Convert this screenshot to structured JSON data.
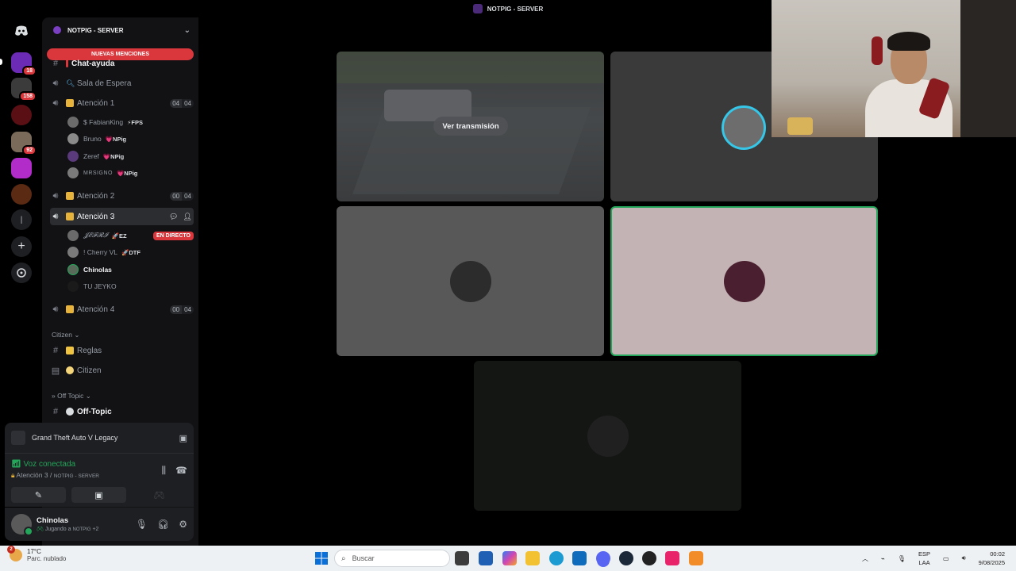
{
  "window": {
    "title": "NOTPIG - SERVER"
  },
  "server_rail": {
    "badges": [
      "18",
      "158",
      "92"
    ]
  },
  "sidebar": {
    "server_name": "NOTPIG - SERVER",
    "mentions_pill": "NUEVAS MENCIONES",
    "channels": [
      {
        "name": "Chat-ayuda",
        "type": "text"
      },
      {
        "name": "Sala de Espera",
        "type": "voice"
      },
      {
        "name": "Atención 1",
        "type": "voice",
        "count_a": "04",
        "count_b": "04"
      },
      {
        "name": "Atención 2",
        "type": "voice",
        "count_a": "00",
        "count_b": "04"
      },
      {
        "name": "Atención 3",
        "type": "voice"
      },
      {
        "name": "Atención 4",
        "type": "voice",
        "count_a": "00",
        "count_b": "04"
      }
    ],
    "attn1_users": [
      {
        "name": "$ FabianKing",
        "tag": "⚡FPS"
      },
      {
        "name": "Bruno",
        "tag": "💗NPig"
      },
      {
        "name": "Zeref",
        "tag": "💗NPig"
      },
      {
        "name": "MRSIGNO",
        "tag": "💗NPig"
      }
    ],
    "attn3_users": [
      {
        "name": "𝓙𝓔𝓕𝓡𝓘",
        "tag": "🚀EZ",
        "live": "EN DIRECTO"
      },
      {
        "name": "! Cherry VL",
        "tag": "🚀DTF"
      },
      {
        "name": "Chinolas",
        "tag": ""
      },
      {
        "name": "TU JEYKO",
        "tag": ""
      }
    ],
    "category_citizen": "Citizen",
    "citizen_channels": [
      {
        "name": "Reglas"
      },
      {
        "name": "Citizen"
      }
    ],
    "category_offtopic": "» Off Topic",
    "offtopic_channel": "Off-Topic"
  },
  "activity": {
    "game": "Grand Theft Auto V Legacy"
  },
  "voice": {
    "status": "Voz conectada",
    "channel": "Atención 3 / ",
    "server": "NOTPIG - SERVER"
  },
  "user": {
    "name": "Chinolas",
    "activity_prefix": "Jugando a",
    "activity_server": "NOTPIG",
    "extra": "+2"
  },
  "stage": {
    "watch_button": "Ver transmisión"
  },
  "taskbar": {
    "weather_temp": "17°C",
    "weather_desc": "Parc. nublado",
    "weather_badge": "2",
    "search_placeholder": "Buscar",
    "lang_top": "ESP",
    "lang_bottom": "LAA",
    "time": "00:02",
    "date": "9/08/2025"
  }
}
